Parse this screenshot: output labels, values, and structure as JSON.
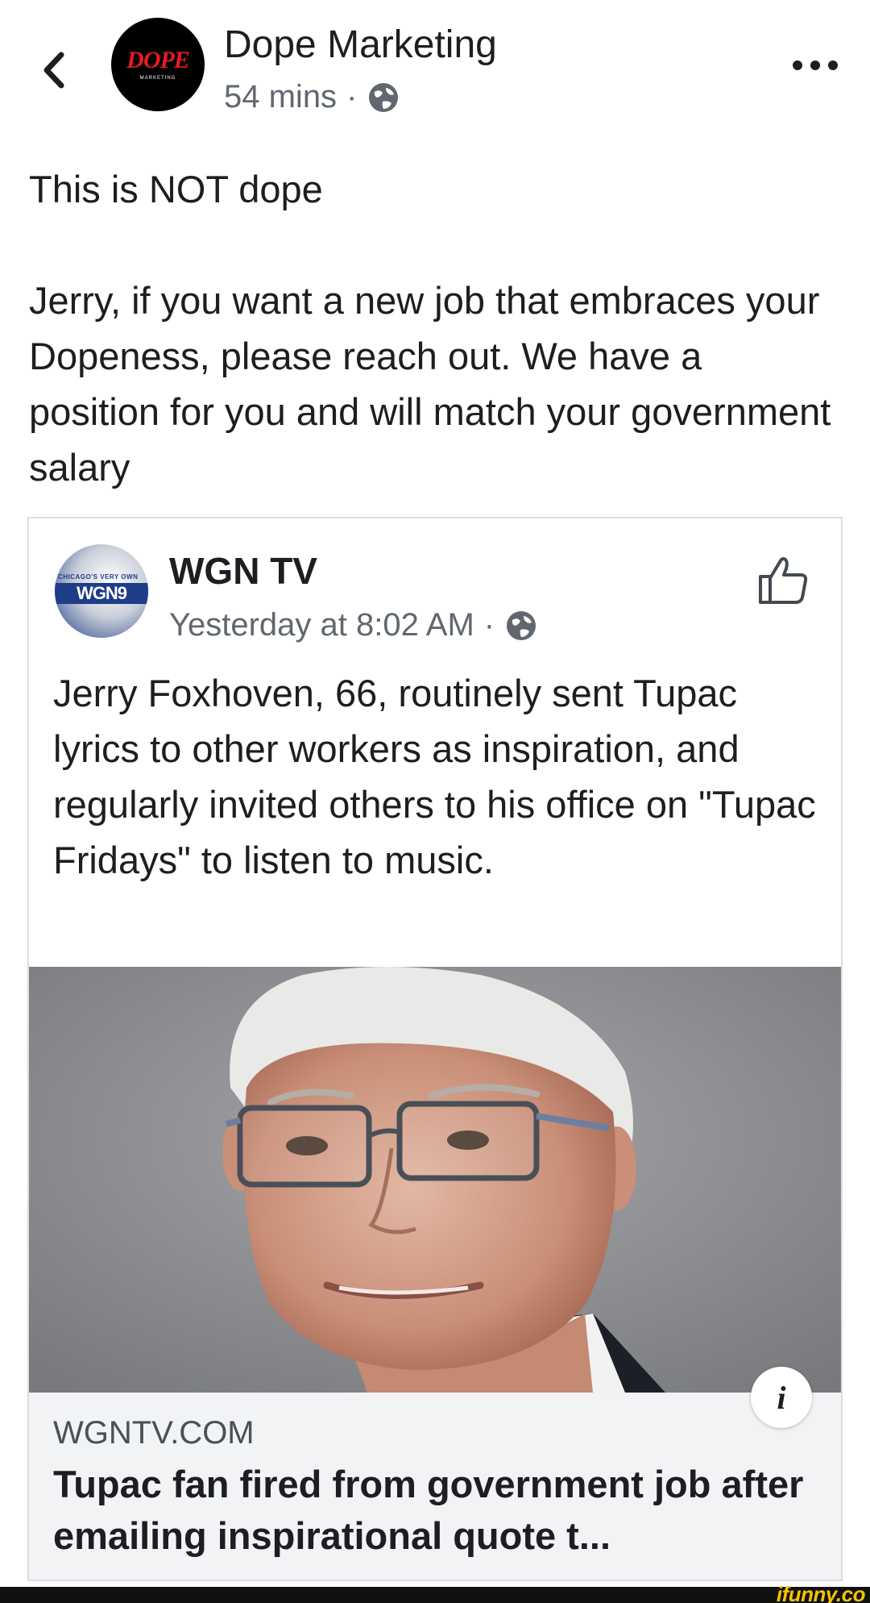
{
  "header": {
    "page_name": "Dope Marketing",
    "time": "54 mins",
    "separator": "·",
    "avatar_text": "DOPE",
    "avatar_subtext": "MARKETING",
    "back_icon": "chevron-left-icon",
    "more_icon": "more-horizontal-icon",
    "privacy_icon": "globe-icon"
  },
  "post": {
    "line1": "This is NOT dope",
    "line2": "Jerry, if you want a new job that embraces your Dopeness, please reach out. We have a position for you and will match your government salary"
  },
  "shared": {
    "source_name": "WGN TV",
    "avatar_text": "WGN9",
    "avatar_tag": "CHICAGO'S VERY OWN",
    "timestamp": "Yesterday at 8:02 AM",
    "separator": "·",
    "privacy_icon": "globe-icon",
    "like_icon": "thumbs-up-icon",
    "text": "Jerry Foxhoven, 66, routinely sent Tupac lyrics to other workers as inspiration, and regularly invited others to his office on \"Tupac Fridays\" to listen to music.",
    "info_label": "i",
    "link": {
      "domain": "WGNTV.COM",
      "title": "Tupac fan fired from government job after emailing inspirational quote t..."
    }
  },
  "watermark": "ifunny.co",
  "colors": {
    "text": "#1c1e21",
    "meta": "#616770",
    "brand_red": "#e41b23",
    "wgn_blue": "#1f3c88",
    "footer_bg": "#f2f3f5",
    "watermark": "#f5c400"
  }
}
